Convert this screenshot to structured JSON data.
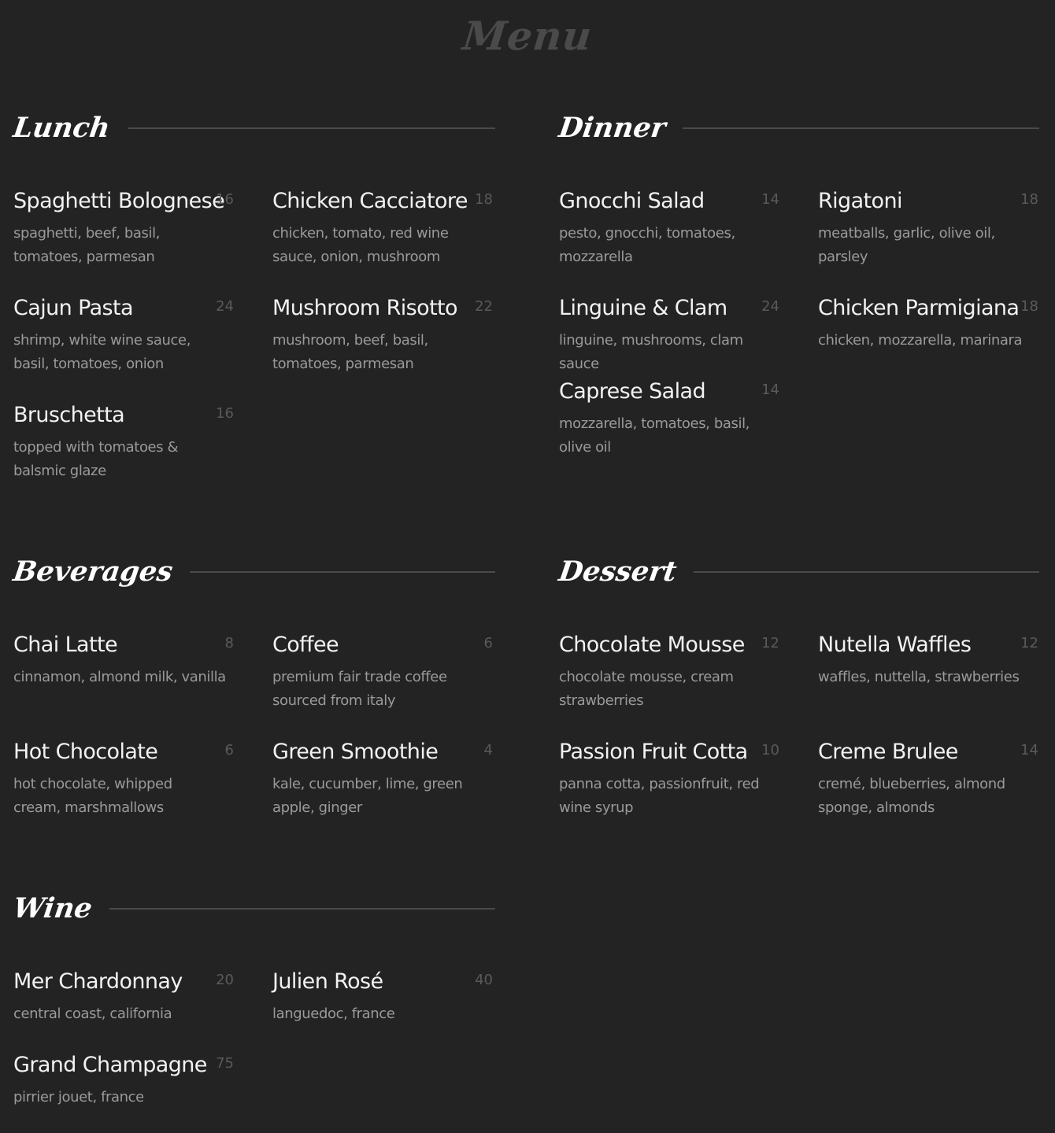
{
  "page": {
    "title": "Menu"
  },
  "sections": {
    "lunch": {
      "title": "Lunch",
      "items": [
        {
          "name": "Spaghetti Bolognese",
          "price": "16",
          "desc": "spaghetti, beef, basil, tomatoes, parmesan"
        },
        {
          "name": "Chicken Cacciatore",
          "price": "18",
          "desc": "chicken, tomato, red wine sauce, onion, mushroom"
        },
        {
          "name": "Cajun Pasta",
          "price": "24",
          "desc": "shrimp, white wine sauce, basil, tomatoes, onion"
        },
        {
          "name": "Mushroom Risotto",
          "price": "22",
          "desc": "mushroom, beef, basil, tomatoes, parmesan"
        },
        {
          "name": "Bruschetta",
          "price": "16",
          "desc": "topped with tomatoes & balsmic glaze"
        }
      ]
    },
    "dinner": {
      "title": "Dinner",
      "items": [
        {
          "name": "Gnocchi Salad",
          "price": "14",
          "desc": "pesto, gnocchi, tomatoes, mozzarella"
        },
        {
          "name": "Rigatoni",
          "price": "18",
          "desc": "meatballs, garlic, olive oil, parsley"
        },
        {
          "name": "Linguine & Clam",
          "price": "24",
          "desc": "linguine, mushrooms, clam sauce"
        },
        {
          "name": "Chicken Parmigiana",
          "price": "18",
          "desc": "chicken, mozzarella, marinara"
        },
        {
          "name": "Caprese Salad",
          "price": "14",
          "desc": "mozzarella, tomatoes, basil, olive oil"
        }
      ]
    },
    "beverages": {
      "title": "Beverages",
      "items": [
        {
          "name": "Chai Latte",
          "price": "8",
          "desc": "cinnamon, almond milk, vanilla"
        },
        {
          "name": "Coffee",
          "price": "6",
          "desc": "premium fair trade coffee sourced from italy"
        },
        {
          "name": "Hot Chocolate",
          "price": "6",
          "desc": "hot chocolate, whipped cream, marshmallows"
        },
        {
          "name": "Green Smoothie",
          "price": "4",
          "desc": "kale, cucumber, lime, green apple, ginger"
        }
      ]
    },
    "dessert": {
      "title": "Dessert",
      "items": [
        {
          "name": "Chocolate Mousse",
          "price": "12",
          "desc": "chocolate mousse, cream strawberries"
        },
        {
          "name": "Nutella Waffles",
          "price": "12",
          "desc": "waffles, nuttella, strawberries"
        },
        {
          "name": "Passion Fruit Cotta",
          "price": "10",
          "desc": "panna cotta, passionfruit, red wine syrup"
        },
        {
          "name": "Creme Brulee",
          "price": "14",
          "desc": "cremé, blueberries, almond sponge, almonds"
        }
      ]
    },
    "wine": {
      "title": "Wine",
      "items": [
        {
          "name": "Mer Chardonnay",
          "price": "20",
          "desc": "central coast, california"
        },
        {
          "name": "Julien Rosé",
          "price": "40",
          "desc": "languedoc, france"
        },
        {
          "name": "Grand Champagne",
          "price": "75",
          "desc": "pirrier jouet, france"
        }
      ]
    }
  },
  "colors": {
    "background": "#232323",
    "title": "#4a4a4a",
    "item_name": "#f2f2f2",
    "price": "#5a5a5a",
    "description": "#9a9a9a",
    "rule": "#4a4a4a"
  }
}
